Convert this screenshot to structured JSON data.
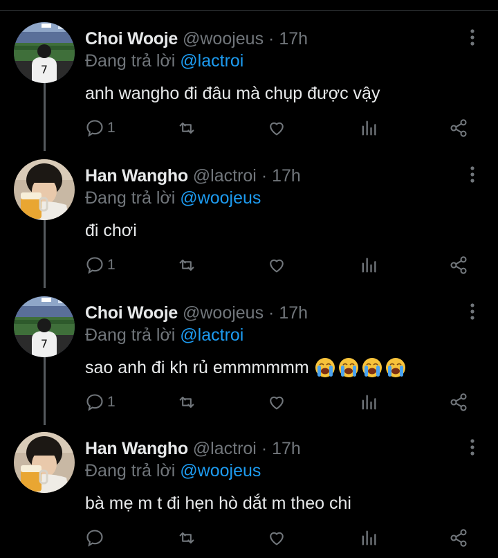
{
  "tweets": [
    {
      "name": "Choi Wooje",
      "handle": "@woojeus",
      "separator": "·",
      "time": "17h",
      "reply_prefix": "Đang trả lời",
      "reply_to": "@lactroi",
      "text": "anh wangho đi đâu mà chụp được vậy",
      "replies": "1",
      "avatar_icon": "stadium-photo-avatar"
    },
    {
      "name": "Han Wangho",
      "handle": "@lactroi",
      "separator": "·",
      "time": "17h",
      "reply_prefix": "Đang trả lời",
      "reply_to": "@woojeus",
      "text": "đi chơi",
      "replies": "1",
      "avatar_icon": "beer-glass-portrait-avatar"
    },
    {
      "name": "Choi Wooje",
      "handle": "@woojeus",
      "separator": "·",
      "time": "17h",
      "reply_prefix": "Đang trả lời",
      "reply_to": "@lactroi",
      "text": "sao anh đi kh rủ emmmmmm",
      "emojis": [
        "loudly-crying-face",
        "loudly-crying-face",
        "loudly-crying-face",
        "loudly-crying-face"
      ],
      "replies": "1",
      "avatar_icon": "stadium-photo-avatar"
    },
    {
      "name": "Han Wangho",
      "handle": "@lactroi",
      "separator": "·",
      "time": "17h",
      "reply_prefix": "Đang trả lời",
      "reply_to": "@woojeus",
      "text": "bà mẹ m t đi hẹn hò dắt m theo chi",
      "replies": "",
      "avatar_icon": "beer-glass-portrait-avatar"
    }
  ],
  "colors": {
    "background": "#000000",
    "text": "#e7e9ea",
    "secondary": "#71767b",
    "mention": "#1d9bf0",
    "thread_line": "#555a5e"
  },
  "icons": [
    "more-options-icon",
    "reply-icon",
    "retweet-icon",
    "like-icon",
    "views-icon",
    "share-icon"
  ]
}
